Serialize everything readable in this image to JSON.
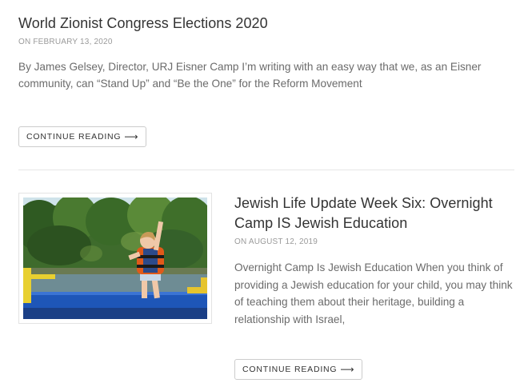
{
  "posts": [
    {
      "title": "World Zionist Congress Elections 2020",
      "date": "ON FEBRUARY 13, 2020",
      "excerpt": "By James Gelsey, Director, URJ Eisner Camp I’m writing with an easy way that we, as an Eisner community, can “Stand Up” and “Be the One” for the Reform Movement",
      "button_label": "CONTINUE READING"
    },
    {
      "title": "Jewish Life Update Week Six: Overnight Camp IS Jewish Education",
      "date": "ON AUGUST 12, 2019",
      "excerpt": "Overnight Camp Is Jewish Education When you think of providing a Jewish education for your child, you may think of teaching them about their heritage, building a relationship with Israel,",
      "button_label": "CONTINUE READING"
    }
  ],
  "icons": {
    "arrow": "long-arrow-right-icon"
  },
  "colors": {
    "text": "#333333",
    "meta": "#9a9a9a",
    "excerpt": "#6b6b6b",
    "border": "#cccccc"
  }
}
